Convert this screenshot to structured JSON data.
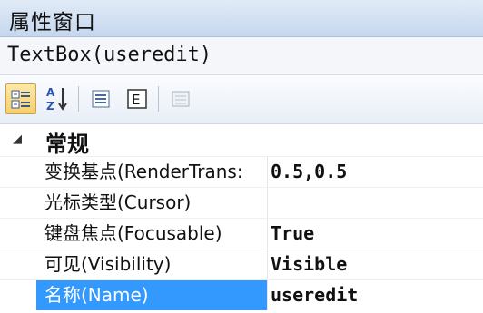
{
  "window": {
    "title": "属性窗口"
  },
  "object": {
    "label": "TextBox(useredit)"
  },
  "toolbar": {
    "buttons": [
      {
        "icon": "categorized-view-icon",
        "active": true
      },
      {
        "icon": "sort-alphabetical-icon",
        "active": false
      },
      {
        "icon": "properties-list-icon",
        "active": false
      },
      {
        "icon": "events-icon",
        "active": false
      },
      {
        "icon": "property-pages-icon",
        "active": false,
        "disabled": true
      }
    ]
  },
  "category": {
    "label": "常规",
    "expanded": true
  },
  "properties": [
    {
      "name": "变换基点(RenderTrans:",
      "value": "0.5,0.5"
    },
    {
      "name": "光标类型(Cursor)",
      "value": ""
    },
    {
      "name": "键盘焦点(Focusable)",
      "value": "True"
    },
    {
      "name": "可见(Visibility)",
      "value": "Visible"
    },
    {
      "name": "名称(Name)",
      "value": "useredit",
      "selected": true
    }
  ],
  "colors": {
    "selection": "#3399ff",
    "titlebar": "#c6d7ee"
  }
}
